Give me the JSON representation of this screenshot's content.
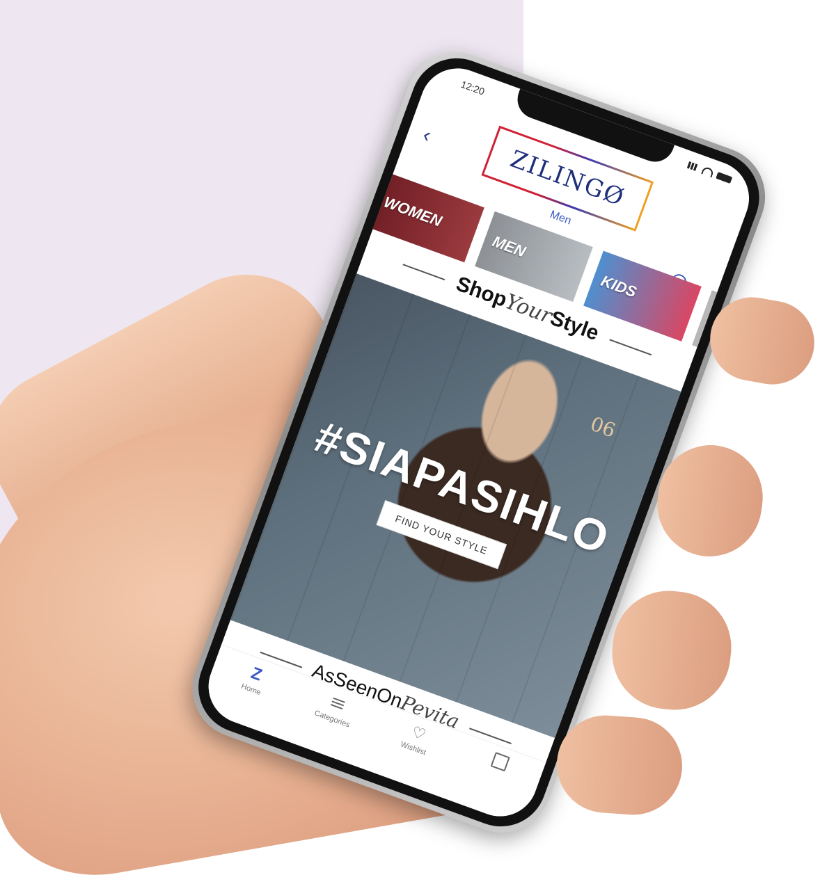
{
  "status_bar": {
    "time": "12:20"
  },
  "brand": {
    "logo_text": "ZILINGØ"
  },
  "nav": {
    "section_label": "Men",
    "back_icon": "chevron-left-icon",
    "search_icon": "search-icon"
  },
  "categories": [
    {
      "label": "WOMEN",
      "name": "category-women"
    },
    {
      "label": "MEN",
      "name": "category-men"
    },
    {
      "label": "KIDS",
      "name": "category-kids"
    }
  ],
  "sections": {
    "shop_your_style": {
      "part1": "Shop",
      "part2": "Your",
      "part3": "Style"
    },
    "as_seen_on": {
      "part1": "AsSeenOn",
      "part2": "Pevita"
    }
  },
  "banner": {
    "hashtag": "#SIAPASIHLO",
    "cta": "FIND YOUR STYLE",
    "locker_number": "06"
  },
  "tabbar": {
    "items": [
      {
        "label": "Home",
        "icon": "zilingo-z-icon"
      },
      {
        "label": "Categories",
        "icon": "list-icon"
      },
      {
        "label": "Wishlist",
        "icon": "heart-icon"
      },
      {
        "label": "",
        "icon": "shopping-bag-icon"
      }
    ]
  },
  "colors": {
    "accent": "#3b59c2",
    "panel_bg": "#eee7f1"
  }
}
